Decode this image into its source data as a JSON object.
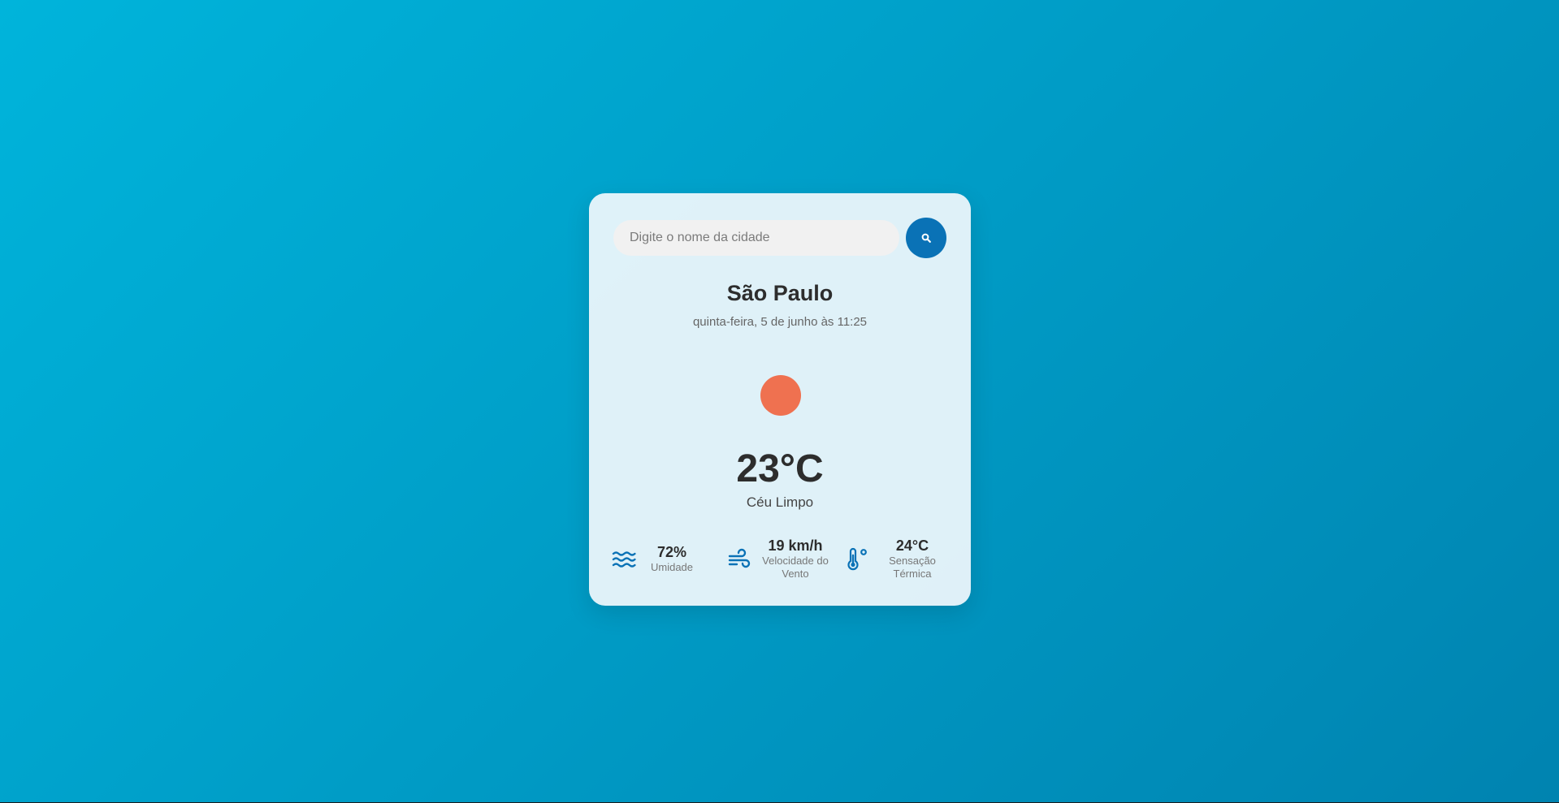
{
  "search": {
    "value": "",
    "placeholder": "Digite o nome da cidade"
  },
  "icons": {
    "search_button": "search-icon",
    "weather": "sun-icon",
    "humidity": "water-waves-icon",
    "wind": "wind-icon",
    "feels_like": "thermometer-icon"
  },
  "weather": {
    "city": "São Paulo",
    "date": "quinta-feira, 5 de junho às 11:25",
    "temperature": "23°C",
    "description": "Céu Limpo"
  },
  "details": {
    "humidity": {
      "value": "72%",
      "label": "Umidade"
    },
    "wind": {
      "value": "19 km/h",
      "label": "Velocidade do Vento"
    },
    "feels_like": {
      "value": "24°C",
      "label": "Sensação Térmica"
    }
  },
  "colors": {
    "accent": "#0a72b6",
    "sun": "#ef7150",
    "background_start": "#00b4db",
    "background_end": "#0083b0"
  }
}
